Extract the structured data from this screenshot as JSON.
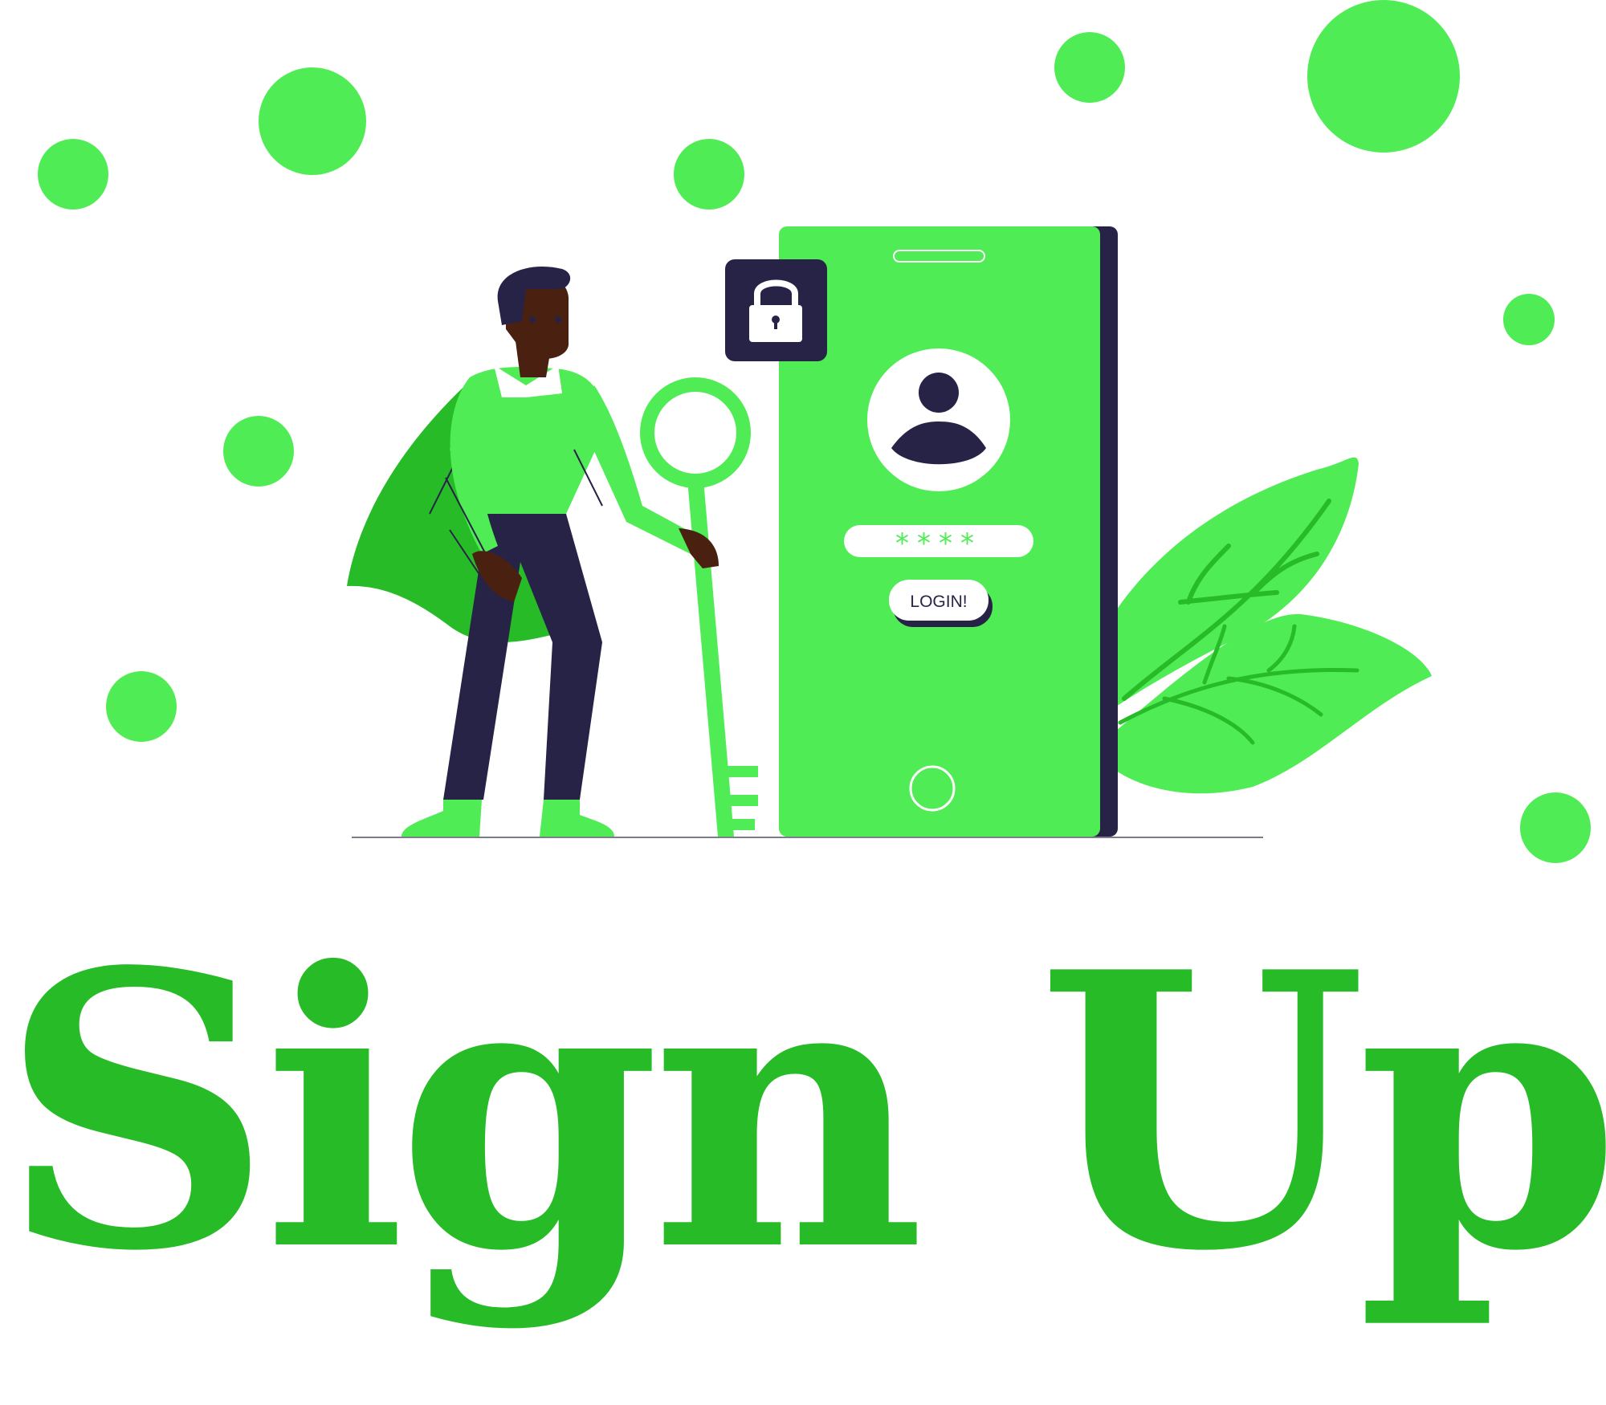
{
  "colors": {
    "accent": "#50EC55",
    "accent_dark": "#26BB27",
    "ink": "#272347",
    "skin": "#4A2110",
    "white": "#FFFFFF",
    "ground_line": "#7D7D8A"
  },
  "illustration": {
    "password_mask": "****",
    "login_button_label": "LOGIN!",
    "icons": [
      "lock-icon",
      "user-avatar-icon",
      "key-icon",
      "leaf-icon",
      "home-button-icon"
    ]
  },
  "headline": "Sign Up"
}
